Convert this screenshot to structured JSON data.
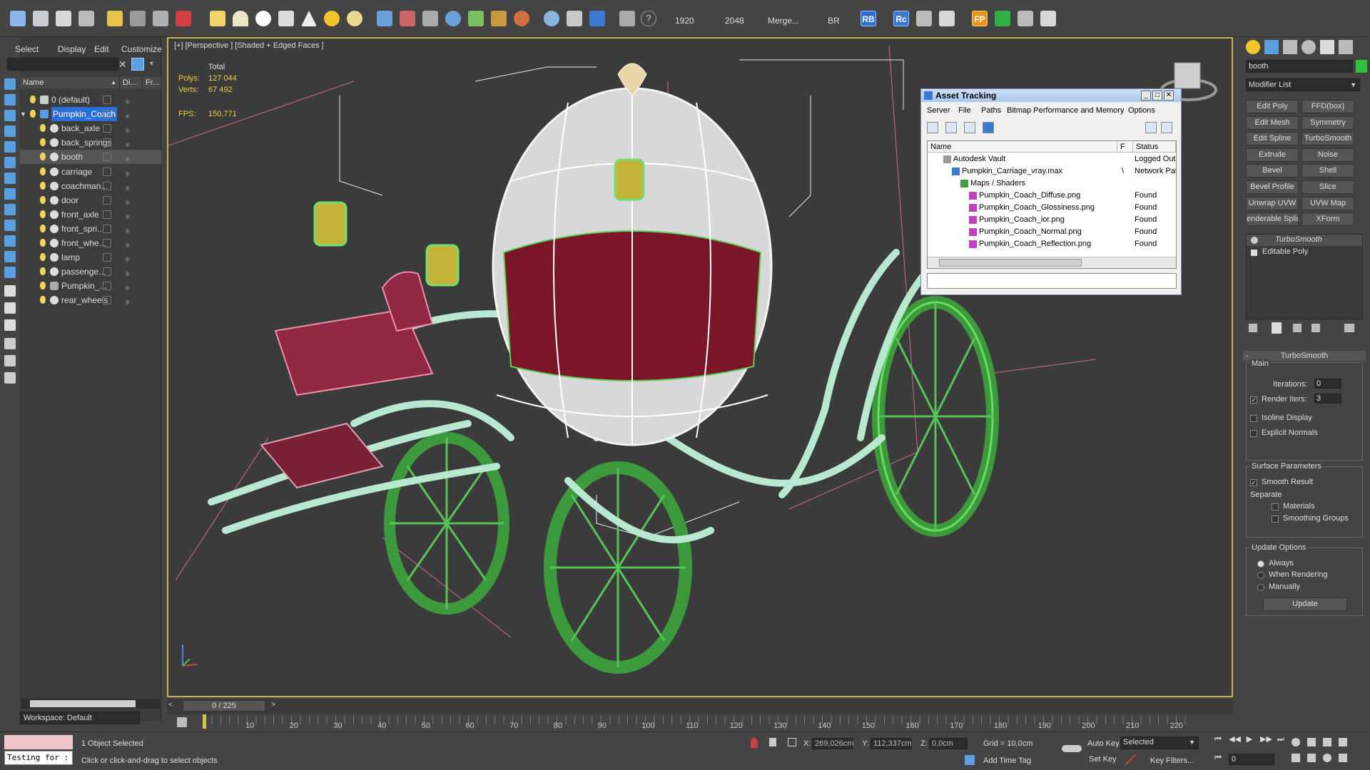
{
  "toolbar": {
    "width_value": "1920",
    "height_value": "2048",
    "merge_label": "Merge...",
    "br_label": "BR",
    "rb_label": "RB",
    "rc_label": "Rc",
    "fp_label": "FP",
    "help_label": "?"
  },
  "explorer": {
    "menu": [
      "Select",
      "Display",
      "Edit",
      "Customize"
    ],
    "columns": [
      "Name",
      "Di...",
      "Fr..."
    ],
    "items": [
      {
        "label": "0 (default)",
        "level": 0
      },
      {
        "label": "Pumpkin_Coach",
        "level": 0
      },
      {
        "label": "back_axle",
        "level": 1
      },
      {
        "label": "back_springs",
        "level": 1
      },
      {
        "label": "booth",
        "level": 1
      },
      {
        "label": "carriage",
        "level": 1
      },
      {
        "label": "coachman...",
        "level": 1
      },
      {
        "label": "door",
        "level": 1
      },
      {
        "label": "front_axle",
        "level": 1
      },
      {
        "label": "front_spri...",
        "level": 1
      },
      {
        "label": "front_whe...",
        "level": 1
      },
      {
        "label": "lamp",
        "level": 1
      },
      {
        "label": "passenge...",
        "level": 1
      },
      {
        "label": "Pumpkin_...",
        "level": 1
      },
      {
        "label": "rear_wheels",
        "level": 1
      }
    ],
    "workspace": "Workspace: Default"
  },
  "viewport": {
    "label": "[+] [Perspective ] [Shaded + Edged Faces ]",
    "stats": {
      "total_label": "Total",
      "polys_label": "Polys:",
      "polys_value": "127 044",
      "verts_label": "Verts:",
      "verts_value": "67 492",
      "fps_label": "FPS:",
      "fps_value": "150,771"
    }
  },
  "asset_tracking": {
    "title": "Asset Tracking",
    "menu": [
      "Server",
      "File",
      "Paths",
      "Bitmap Performance and Memory",
      "Options"
    ],
    "columns": [
      "Name",
      "F",
      "Status"
    ],
    "rows": [
      {
        "name": "Autodesk Vault",
        "flag": "",
        "status": "Logged Out (",
        "indent": 1
      },
      {
        "name": "Pumpkin_Carriage_vray.max",
        "flag": "\\",
        "status": "Network Path",
        "indent": 2
      },
      {
        "name": "Maps / Shaders",
        "flag": "",
        "status": "",
        "indent": 3
      },
      {
        "name": "Pumpkin_Coach_Diffuse.png",
        "flag": "",
        "status": "Found",
        "indent": 4
      },
      {
        "name": "Pumpkin_Coach_Glossiness.png",
        "flag": "",
        "status": "Found",
        "indent": 4
      },
      {
        "name": "Pumpkin_Coach_ior.png",
        "flag": "",
        "status": "Found",
        "indent": 4
      },
      {
        "name": "Pumpkin_Coach_Normal.png",
        "flag": "",
        "status": "Found",
        "indent": 4
      },
      {
        "name": "Pumpkin_Coach_Reflection.png",
        "flag": "",
        "status": "Found",
        "indent": 4
      }
    ]
  },
  "command_panel": {
    "object_name": "booth",
    "modifier_list": "Modifier List",
    "buttons": [
      "Edit Poly",
      "FFD(box)",
      "Edit Mesh",
      "Symmetry",
      "Edit Spline",
      "TurboSmooth",
      "Extrude",
      "Noise",
      "Bevel",
      "Shell",
      "Bevel Profile",
      "Slice",
      "Unwrap UVW",
      "UVW Map",
      "enderable Splir",
      "XForm"
    ],
    "stack": [
      "TurboSmooth",
      "Editable Poly"
    ],
    "rollout_title": "TurboSmooth",
    "main_label": "Main",
    "iterations_label": "Iterations:",
    "iterations_value": "0",
    "render_iters_label": "Render Iters:",
    "render_iters_value": "3",
    "isoline_label": "Isoline Display",
    "explicit_normals_label": "Explicit Normals",
    "surface_params_label": "Surface Parameters",
    "smooth_result_label": "Smooth Result",
    "separate_label": "Separate",
    "materials_label": "Materials",
    "smoothing_groups_label": "Smoothing Groups",
    "update_options_label": "Update Options",
    "always_label": "Always",
    "when_rendering_label": "When Rendering",
    "manually_label": "Manually",
    "update_button": "Update"
  },
  "timeline": {
    "frame_counter": "0 / 225",
    "ticks": [
      "10",
      "20",
      "30",
      "40",
      "50",
      "60",
      "70",
      "80",
      "90",
      "100",
      "110",
      "120",
      "130",
      "140",
      "150",
      "160",
      "170",
      "180",
      "190",
      "200",
      "210",
      "220"
    ]
  },
  "status": {
    "script_text": "Testing for :",
    "selection_text": "1 Object Selected",
    "prompt_text": "Click or click-and-drag to select objects",
    "x_label": "X:",
    "x_value": "269,026cm",
    "y_label": "Y:",
    "y_value": "112,337cm",
    "z_label": "Z:",
    "z_value": "0,0cm",
    "grid_text": "Grid = 10,0cm",
    "add_time_tag": "Add Time Tag",
    "auto_key": "Auto Key",
    "set_key": "Set Key",
    "selected_value": "Selected",
    "key_filters": "Key Filters...",
    "frame_value": "0"
  }
}
